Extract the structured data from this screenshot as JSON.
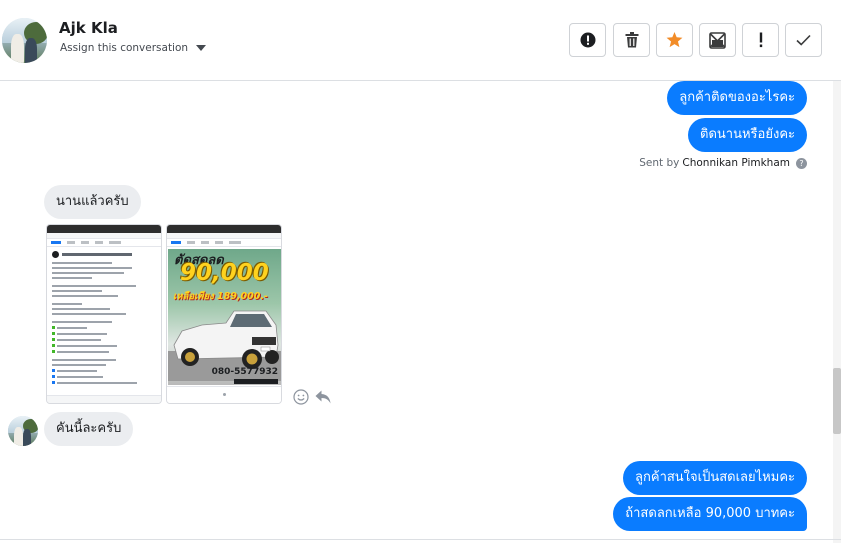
{
  "contact": {
    "name": "Ajk Kla",
    "assign_label": "Assign this conversation"
  },
  "toolbar": {
    "buttons": [
      {
        "icon": "alert-circle-icon"
      },
      {
        "icon": "trash-icon"
      },
      {
        "icon": "star-icon"
      },
      {
        "icon": "mail-icon"
      },
      {
        "icon": "exclamation-icon"
      },
      {
        "icon": "check-icon"
      }
    ],
    "star_color": "#f28c28"
  },
  "messages": {
    "out1": "ลูกค้าติดของอะไรคะ",
    "out2": "ติดนานหรือยังคะ",
    "sent_by_prefix": "Sent by",
    "sent_by_name": "Chonnikan Pimkham",
    "in1": "นานแล้วครับ",
    "in2": "คันนี้ละครับ",
    "out3": "ลูกค้าสนใจเป็นสดเลยไหมคะ",
    "out4": "ถ้าสดลกเหลือ 90,000 บาทคะ"
  },
  "ad": {
    "headline_top": "ตัดสดลด",
    "amount": "90,000",
    "remain_label": "เหลือเพียง 189,000.-",
    "phone": "080-5577932"
  },
  "colors": {
    "outgoing": "#0a7cff",
    "incoming": "#ebedf0"
  }
}
